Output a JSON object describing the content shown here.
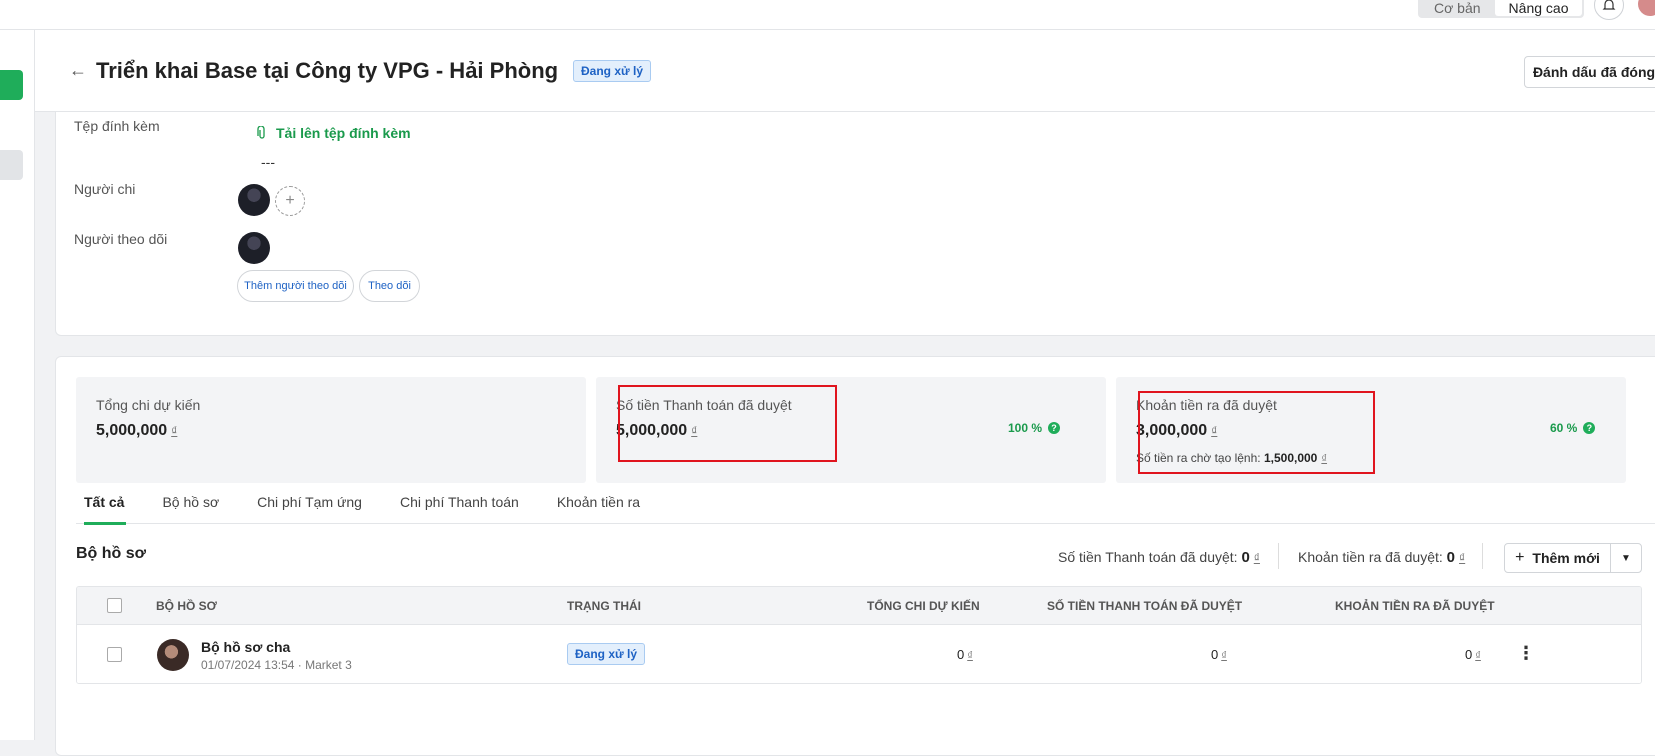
{
  "topbar": {
    "mode_basic": "Cơ bản",
    "mode_advanced": "Nâng cao"
  },
  "header": {
    "title": "Triển khai Base tại Công ty VPG - Hải Phòng",
    "status": "Đang xử lý",
    "close_button": "Đánh dấu đã đóng"
  },
  "details": {
    "attachments_label": "Tệp đính kèm",
    "upload_link": "Tải lên tệp đính kèm",
    "attachments_value": "---",
    "payer_label": "Người chi",
    "add_symbol": "+",
    "followers_label": "Người theo dõi",
    "add_follower_button": "Thêm người theo dõi",
    "follow_button": "Theo dõi"
  },
  "stats": {
    "currency": "₫",
    "total": {
      "label": "Tổng chi dự kiến",
      "value": "5,000,000"
    },
    "payment": {
      "label": "Số tiền Thanh toán đã duyệt",
      "value": "5,000,000",
      "percent": "100 %"
    },
    "outflow": {
      "label": "Khoản tiền ra đã duyệt",
      "value": "3,000,000",
      "percent": "60 %",
      "pending_label": "Số tiền ra chờ tạo lệnh:",
      "pending_value": "1,500,000"
    },
    "help_symbol": "?"
  },
  "tabs": [
    "Tất cả",
    "Bộ hồ sơ",
    "Chi phí Tạm ứng",
    "Chi phí Thanh toán",
    "Khoản tiền ra"
  ],
  "section": {
    "title": "Bộ hồ sơ",
    "payment_summary_label": "Số tiền Thanh toán đã duyệt:",
    "payment_summary_value": "0",
    "outflow_summary_label": "Khoản tiền ra đã duyệt:",
    "outflow_summary_value": "0",
    "add_button": "Thêm mới"
  },
  "table": {
    "columns": [
      "BỘ HỒ SƠ",
      "TRẠNG THÁI",
      "TỔNG CHI DỰ KIẾN",
      "SỐ TIỀN THANH TOÁN ĐÃ DUYỆT",
      "KHOẢN TIỀN RA ĐÃ DUYỆT"
    ],
    "rows": [
      {
        "name": "Bộ hồ sơ cha",
        "meta": "01/07/2024 13:54 · Market 3",
        "status": "Đang xử lý",
        "total": "0",
        "payment": "0",
        "outflow": "0"
      }
    ]
  },
  "colors": {
    "accent_green": "#1fad5a",
    "status_blue": "#1e62c4",
    "highlight_red": "#e0141e"
  }
}
